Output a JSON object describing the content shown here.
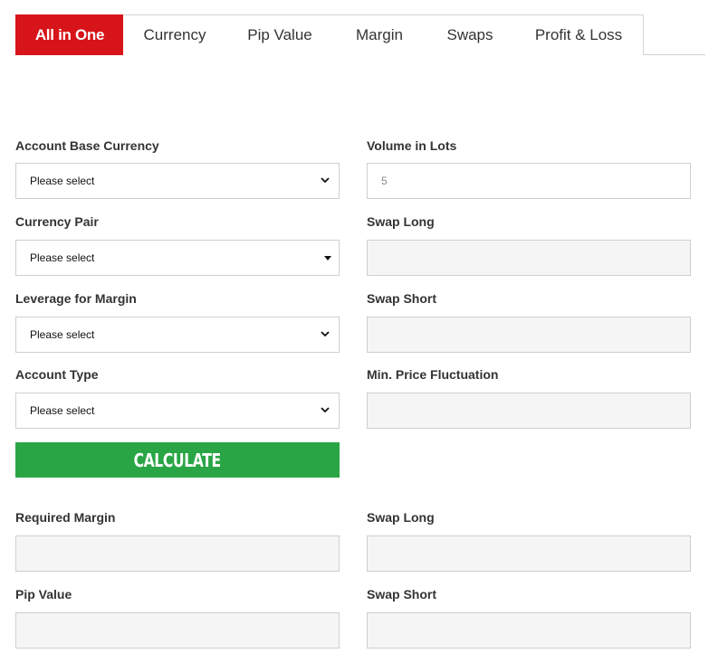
{
  "tabs": [
    {
      "label": "All in One",
      "active": true
    },
    {
      "label": "Currency"
    },
    {
      "label": "Pip Value"
    },
    {
      "label": "Margin"
    },
    {
      "label": "Swaps"
    },
    {
      "label": "Profit & Loss"
    }
  ],
  "form": {
    "account_base_currency": {
      "label": "Account Base Currency",
      "value": "Please select"
    },
    "currency_pair": {
      "label": "Currency Pair",
      "value": "Please select"
    },
    "leverage_for_margin": {
      "label": "Leverage for Margin",
      "value": "Please select"
    },
    "account_type": {
      "label": "Account Type",
      "value": "Please select"
    },
    "volume_in_lots": {
      "label": "Volume in Lots",
      "placeholder": "5"
    },
    "swap_long": {
      "label": "Swap Long",
      "value": ""
    },
    "swap_short": {
      "label": "Swap Short",
      "value": ""
    },
    "min_price_fluctuation": {
      "label": "Min. Price Fluctuation",
      "value": ""
    }
  },
  "calculate_label": "CALCULATE",
  "results": {
    "required_margin": {
      "label": "Required Margin",
      "value": ""
    },
    "swap_long": {
      "label": "Swap Long",
      "value": ""
    },
    "pip_value": {
      "label": "Pip Value",
      "value": ""
    },
    "swap_short": {
      "label": "Swap Short",
      "value": ""
    }
  },
  "colors": {
    "accent": "#d7141a",
    "calculate": "#2aa545",
    "readonly_bg": "#f5f5f5"
  }
}
